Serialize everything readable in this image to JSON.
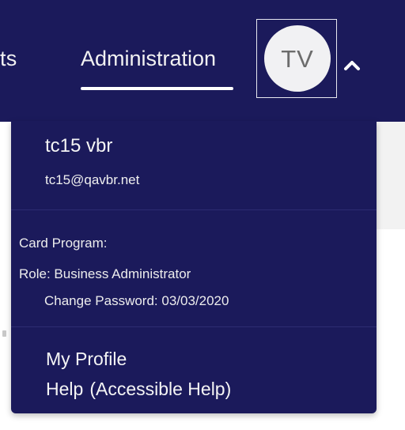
{
  "topnav": {
    "partial_tab_label": "ts",
    "active_tab_label": "Administration"
  },
  "avatar": {
    "initials": "TV",
    "toggle_icon": "chevron-up-icon"
  },
  "user_menu": {
    "name": "tc15 vbr",
    "email": "tc15@qavbr.net",
    "card_program": "Card Program:",
    "role": "Role: Business Administrator",
    "change_password": "Change Password: 03/03/2020",
    "my_profile": "My Profile",
    "help": "Help",
    "accessible_help": "(Accessible Help)"
  },
  "colors": {
    "nav_background": "#1b1a5b",
    "dropdown_background": "#1b1a5b",
    "text": "#f5f5f5",
    "avatar_background": "#f1f1f3"
  }
}
